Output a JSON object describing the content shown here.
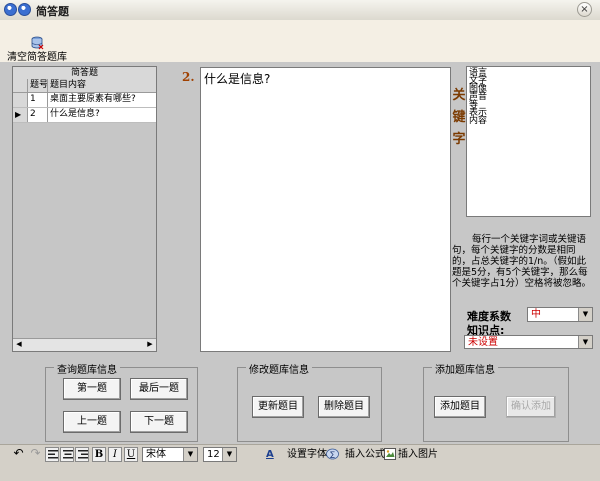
{
  "window": {
    "title": "简答题",
    "close": "×"
  },
  "toolbar": {
    "clear_label": "清空简答题库"
  },
  "grid": {
    "title": "简答题",
    "headers": [
      "题号",
      "题目内容"
    ],
    "rows": [
      {
        "marker": "",
        "num": "1",
        "content": "桌面主要原素有哪些?"
      },
      {
        "marker": "▶",
        "num": "2",
        "content": "什么是信息?"
      }
    ]
  },
  "question": {
    "number": "2.",
    "text": "什么是信息?"
  },
  "keywords": {
    "label": [
      "关",
      "键",
      "字"
    ],
    "items": [
      "语言",
      "文字",
      "图像",
      "声音",
      "等",
      "表示",
      "内容"
    ],
    "help": "每行一个关键字词或关键语句，每个关键字的分数是相同的，占总关键字的1/n。（假如此题是5分，有5个关键字，那么每个关键字占1分）空格将被忽略。"
  },
  "difficulty": {
    "label": "难度系数",
    "value": "中"
  },
  "knowledge": {
    "label": "知识点:",
    "value": "未设置"
  },
  "groups": {
    "query": {
      "caption": "查询题库信息",
      "first": "第一题",
      "last": "最后一题",
      "prev": "上一题",
      "next": "下一题"
    },
    "modify": {
      "caption": "修改题库信息",
      "update": "更新题目",
      "delete": "删除题目"
    },
    "add": {
      "caption": "添加题库信息",
      "add": "添加题目",
      "confirm": "确认添加"
    }
  },
  "format": {
    "bold": "B",
    "italic": "I",
    "underline": "U",
    "font": "宋体",
    "size": "12",
    "set_font": "设置字体",
    "insert_formula": "插入公式",
    "insert_image": "插入图片"
  },
  "colors": {
    "accent": "#a04000",
    "difficulty_value": "#cc0000",
    "knowledge_value": "#cc0000"
  }
}
